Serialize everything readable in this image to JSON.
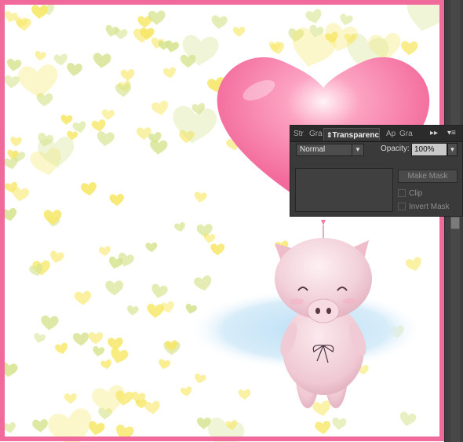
{
  "panel": {
    "tabs": [
      {
        "label": "Str",
        "active": false
      },
      {
        "label": "Gra",
        "active": false
      },
      {
        "label": "Transparency",
        "active": true
      },
      {
        "label": "Ap",
        "active": false
      },
      {
        "label": "Gra",
        "active": false
      }
    ],
    "active_tab_icon": "swap-arrows-icon",
    "collapse_icon": "double-arrow-icon",
    "menu_icon": "panel-menu-icon",
    "blend_mode": "Normal",
    "opacity_label": "Opacity:",
    "opacity_value": "100%",
    "make_mask_label": "Make Mask",
    "clip_label": "Clip",
    "invert_mask_label": "Invert Mask"
  },
  "colors": {
    "border_pink": "#f06a9b",
    "balloon_pink": "#f57aa6",
    "pig_pink": "#f3cfd8",
    "shadow_blue": "#c9e6f7",
    "heart_yellow": "#f7e766",
    "heart_green": "#d6e38f",
    "panel_bg": "#3a3a3a"
  }
}
